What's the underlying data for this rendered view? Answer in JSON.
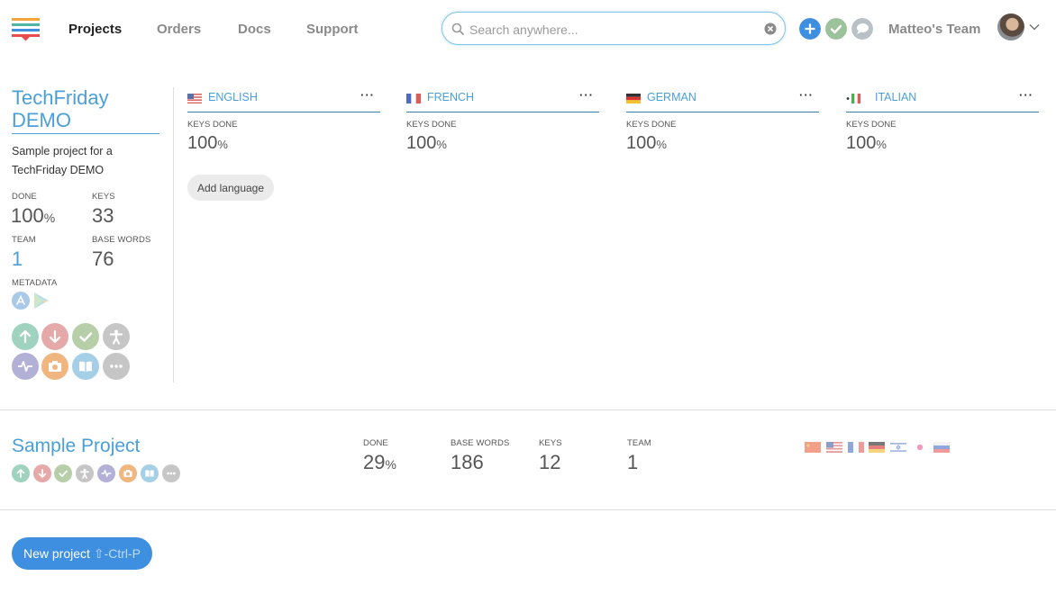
{
  "header": {
    "logo_icon": "stacked-bars-logo",
    "nav": [
      {
        "label": "Projects",
        "active": true
      },
      {
        "label": "Orders",
        "active": false
      },
      {
        "label": "Docs",
        "active": false
      },
      {
        "label": "Support",
        "active": false
      }
    ],
    "search": {
      "placeholder": "Search anywhere...",
      "value": ""
    },
    "quick_actions": [
      {
        "icon": "plus-icon",
        "color": "#3f8fe0"
      },
      {
        "icon": "check-icon",
        "color": "#9bc29a"
      },
      {
        "icon": "chat-icon",
        "color": "#b9c0c6"
      }
    ],
    "team_name": "Matteo's Team"
  },
  "project1": {
    "title_line1": "TechFriday",
    "title_line2": "DEMO",
    "description": "Sample project for a TechFriday DEMO",
    "stats": {
      "done_label": "DONE",
      "done_value": "100",
      "done_unit": "%",
      "keys_label": "KEYS",
      "keys_value": "33",
      "team_label": "TEAM",
      "team_value": "1",
      "base_words_label": "BASE WORDS",
      "base_words_value": "76"
    },
    "metadata_label": "METADATA",
    "actions": [
      {
        "icon": "upload-icon",
        "color": "#9fd3c0"
      },
      {
        "icon": "download-icon",
        "color": "#e6a9a9"
      },
      {
        "icon": "check-icon",
        "color": "#b6cfa9"
      },
      {
        "icon": "person-icon",
        "color": "#c6c6c6"
      },
      {
        "icon": "activity-icon",
        "color": "#b3b0d8"
      },
      {
        "icon": "camera-icon",
        "color": "#f0b680"
      },
      {
        "icon": "book-icon",
        "color": "#a5cfe6"
      },
      {
        "icon": "more-icon",
        "color": "#c6c6c6"
      }
    ],
    "languages": [
      {
        "name": "ENGLISH",
        "flag": "us",
        "keys_label": "KEYS DONE",
        "keys_value": "100",
        "unit": "%"
      },
      {
        "name": "FRENCH",
        "flag": "fr",
        "keys_label": "KEYS DONE",
        "keys_value": "100",
        "unit": "%"
      },
      {
        "name": "GERMAN",
        "flag": "de",
        "keys_label": "KEYS DONE",
        "keys_value": "100",
        "unit": "%"
      },
      {
        "name": "ITALIAN",
        "flag": "it",
        "keys_label": "KEYS DONE",
        "keys_value": "100",
        "unit": "%"
      }
    ],
    "more_label": "···",
    "add_language_label": "Add language"
  },
  "project2": {
    "title": "Sample Project",
    "stats": {
      "done_label": "DONE",
      "done_value": "29",
      "done_unit": "%",
      "base_words_label": "BASE WORDS",
      "base_words_value": "186",
      "keys_label": "KEYS",
      "keys_value": "12",
      "team_label": "TEAM",
      "team_value": "1"
    },
    "language_flags": [
      "cn",
      "us",
      "fr",
      "de",
      "il",
      "jp",
      "ru"
    ]
  },
  "new_project": {
    "label": "New project",
    "shortcut": "⇧-Ctrl-P"
  }
}
